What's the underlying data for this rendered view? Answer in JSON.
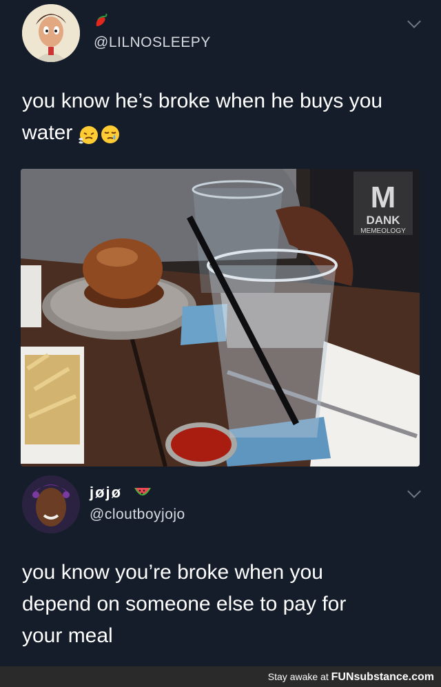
{
  "tweet1": {
    "name_emoji": "hot-pepper",
    "handle": "@LILNOSLEEPY",
    "text_line1": "you know he’s broke when he buys you",
    "text_line2": "water",
    "emoji": [
      "face-with-steam",
      "sleepy-face"
    ]
  },
  "photo": {
    "watermark_top": "DANK",
    "watermark_bottom": "MEMEOLOGY"
  },
  "tweet2": {
    "name": "jøjø",
    "name_emoji": "watermelon",
    "handle": "@cloutboyjojo",
    "text_line1": "you know you’re broke when you",
    "text_line2": "depend on someone else to pay for",
    "text_line3": "your meal"
  },
  "footer": {
    "prefix": "Stay awake at ",
    "brand": "FUNsubstance.com"
  },
  "colors": {
    "background": "#161d2a",
    "footer": "#2a2a2a"
  }
}
